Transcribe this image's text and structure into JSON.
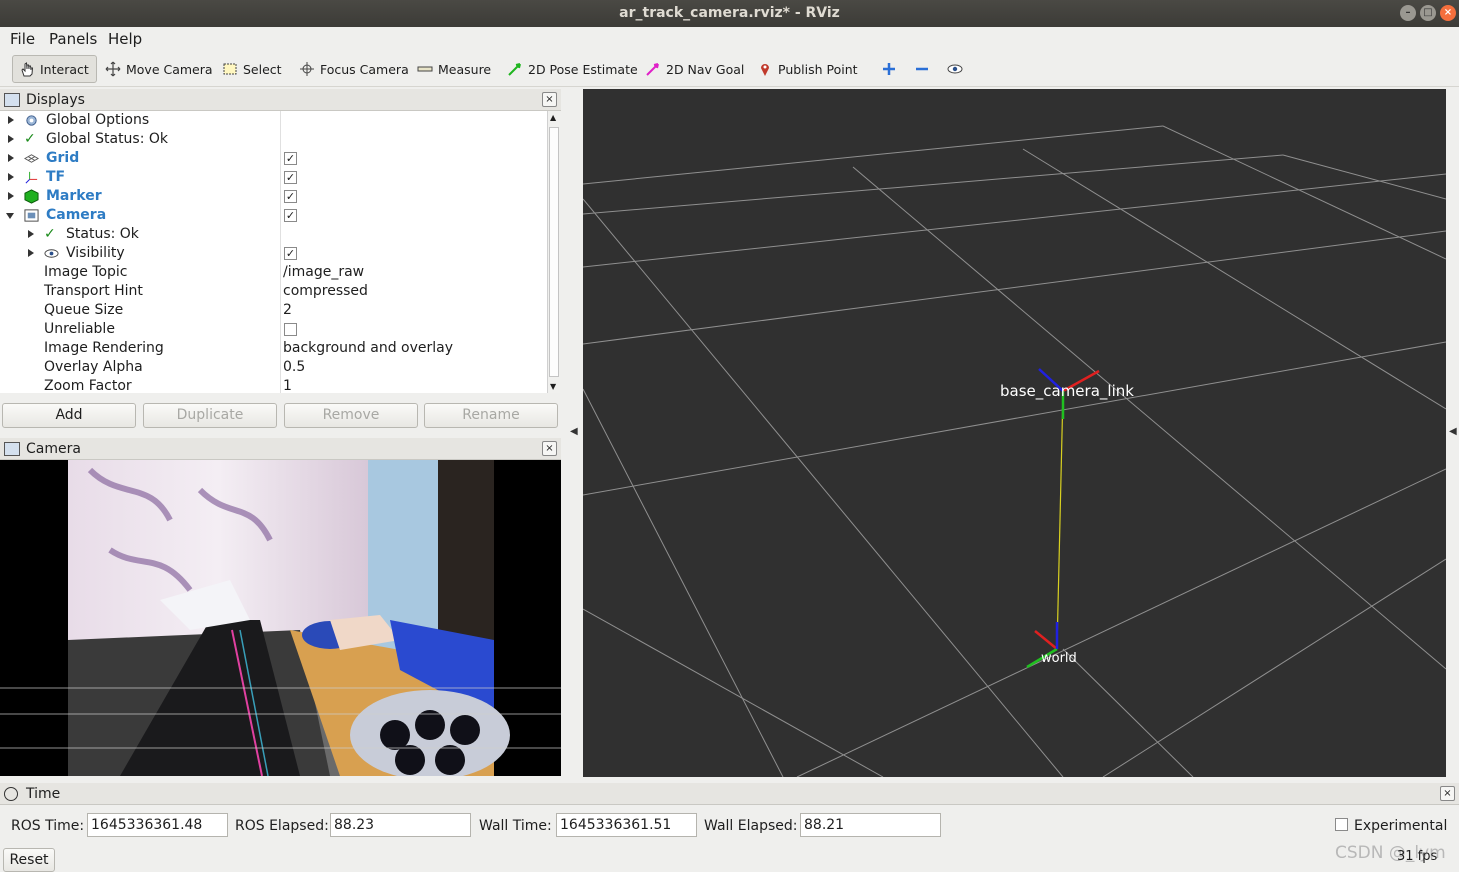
{
  "window": {
    "title": "ar_track_camera.rviz* - RViz"
  },
  "menu": {
    "file": "File",
    "panels": "Panels",
    "help": "Help"
  },
  "toolbar": {
    "interact": "Interact",
    "move_camera": "Move Camera",
    "select": "Select",
    "focus_camera": "Focus Camera",
    "measure": "Measure",
    "pose_estimate": "2D Pose Estimate",
    "nav_goal": "2D Nav Goal",
    "publish_point": "Publish Point"
  },
  "displays": {
    "title": "Displays",
    "rows": [
      {
        "name": "Global Options",
        "value": ""
      },
      {
        "name": "Global Status: Ok",
        "value": ""
      },
      {
        "name": "Grid",
        "checked": true
      },
      {
        "name": "TF",
        "checked": true
      },
      {
        "name": "Marker",
        "checked": true
      },
      {
        "name": "Camera",
        "checked": true
      },
      {
        "name": "Status: Ok",
        "value": ""
      },
      {
        "name": "Visibility",
        "checked": true
      },
      {
        "name": "Image Topic",
        "value": "/image_raw"
      },
      {
        "name": "Transport Hint",
        "value": "compressed"
      },
      {
        "name": "Queue Size",
        "value": "2"
      },
      {
        "name": "Unreliable",
        "checked": false
      },
      {
        "name": "Image Rendering",
        "value": "background and overlay"
      },
      {
        "name": "Overlay Alpha",
        "value": "0.5"
      },
      {
        "name": "Zoom Factor",
        "value": "1"
      }
    ],
    "buttons": {
      "add": "Add",
      "duplicate": "Duplicate",
      "remove": "Remove",
      "rename": "Rename"
    }
  },
  "camera_panel": {
    "title": "Camera"
  },
  "view3d": {
    "frame_base": "base_camera_link",
    "frame_world": "world"
  },
  "time": {
    "title": "Time",
    "ros_time_label": "ROS Time:",
    "ros_time": "1645336361.48",
    "ros_elapsed_label": "ROS Elapsed:",
    "ros_elapsed": "88.23",
    "wall_time_label": "Wall Time:",
    "wall_time": "1645336361.51",
    "wall_elapsed_label": "Wall Elapsed:",
    "wall_elapsed": "88.21",
    "experimental": "Experimental",
    "reset": "Reset",
    "fps": "31 fps",
    "watermark": "CSDN @_lym"
  }
}
